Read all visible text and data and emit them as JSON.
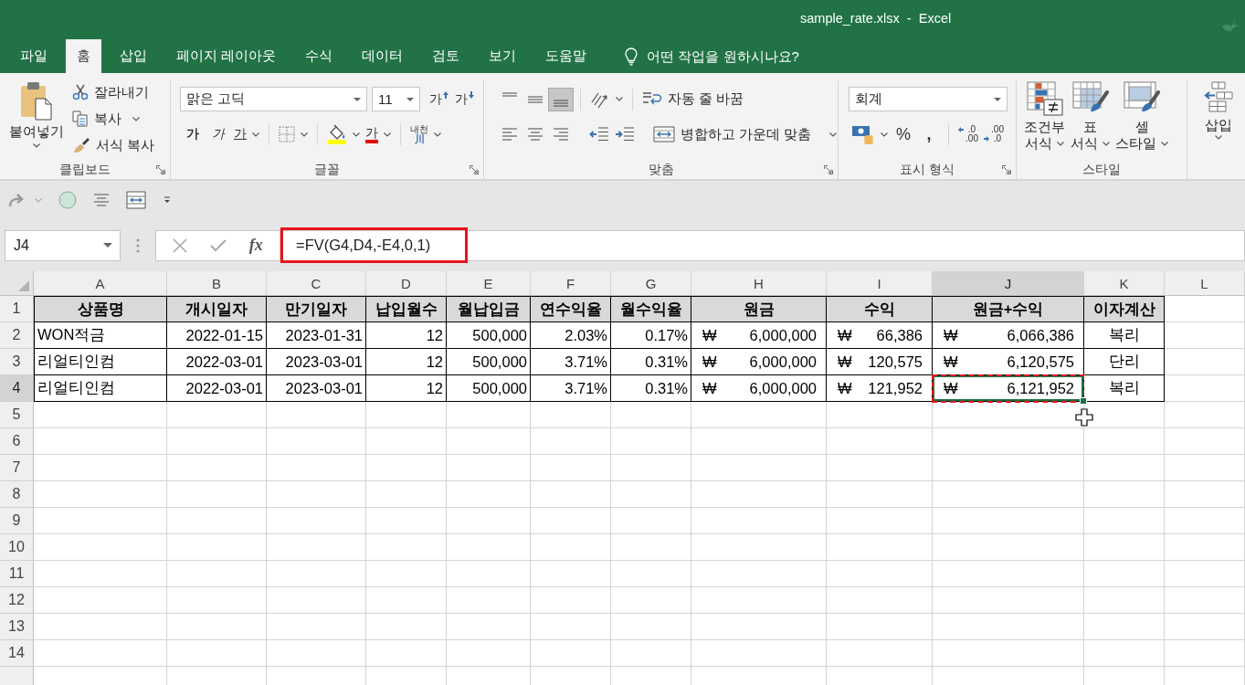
{
  "window": {
    "title": "sample_rate.xlsx  -  Excel"
  },
  "menu_tabs": [
    {
      "label": "파일",
      "selected": false
    },
    {
      "label": "홈",
      "selected": true
    },
    {
      "label": "삽입",
      "selected": false
    },
    {
      "label": "페이지 레이아웃",
      "selected": false
    },
    {
      "label": "수식",
      "selected": false
    },
    {
      "label": "데이터",
      "selected": false
    },
    {
      "label": "검토",
      "selected": false
    },
    {
      "label": "보기",
      "selected": false
    },
    {
      "label": "도움말",
      "selected": false
    }
  ],
  "tell_me": {
    "placeholder": "어떤 작업을 원하시나요?"
  },
  "ribbon": {
    "clipboard": {
      "title": "클립보드",
      "paste": "붙여넣기",
      "cut": "잘라내기",
      "copy": "복사",
      "format_painter": "서식 복사"
    },
    "font": {
      "title": "글꼴",
      "font_name": "맑은 고딕",
      "font_size": "11",
      "grow": "가",
      "shrink": "가",
      "bold": "가",
      "italic": "가",
      "underline": "가",
      "font_color": "가",
      "phonetic": {
        "top": "내천",
        "bottom": "川"
      }
    },
    "alignment": {
      "title": "맞춤",
      "vertical": [
        {
          "kind": "top",
          "selected": false
        },
        {
          "kind": "middle",
          "selected": false
        },
        {
          "kind": "bottom",
          "selected": true
        }
      ],
      "horizontal": [
        {
          "kind": "left",
          "selected": false
        },
        {
          "kind": "center",
          "selected": false
        },
        {
          "kind": "right",
          "selected": false
        }
      ],
      "wrap_text": "자동 줄 바꿈",
      "merge_center": "병합하고 가운데 맞춤"
    },
    "number": {
      "title": "표시 형식",
      "format": "회계",
      "percent": "%",
      "comma": ",",
      "increase_decimal": {
        "top": ".0",
        "bottom": ".00"
      },
      "decrease_decimal": {
        "top": ".00",
        "bottom": ".0"
      }
    },
    "styles": {
      "title": "스타일",
      "buttons": [
        {
          "kind": "conditional",
          "lines": [
            "조건부",
            "서식"
          ]
        },
        {
          "kind": "table",
          "lines": [
            "표",
            "서식"
          ]
        },
        {
          "kind": "cell",
          "lines": [
            "셀",
            "스타일"
          ]
        }
      ]
    },
    "cells": {
      "insert": "삽입"
    }
  },
  "formula_bar": {
    "name_box": "J4",
    "function_label": "fx",
    "formula": "=FV(G4,D4,-E4,0,1)",
    "highlighted": true
  },
  "grid": {
    "columns": [
      {
        "label": "A",
        "selected": false
      },
      {
        "label": "B",
        "selected": false
      },
      {
        "label": "C",
        "selected": false
      },
      {
        "label": "D",
        "selected": false
      },
      {
        "label": "E",
        "selected": false
      },
      {
        "label": "F",
        "selected": false
      },
      {
        "label": "G",
        "selected": false
      },
      {
        "label": "H",
        "selected": false
      },
      {
        "label": "I",
        "selected": false
      },
      {
        "label": "J",
        "selected": true
      },
      {
        "label": "K",
        "selected": false
      },
      {
        "label": "L",
        "selected": false
      }
    ],
    "rows": [
      {
        "label": "1",
        "selected": false,
        "cells": [
          {
            "kind": "header",
            "text": "상품명",
            "selected": false
          },
          {
            "kind": "header",
            "text": "개시일자",
            "selected": false
          },
          {
            "kind": "header",
            "text": "만기일자",
            "selected": false
          },
          {
            "kind": "header",
            "text": "납입월수",
            "selected": false
          },
          {
            "kind": "header",
            "text": "월납입금",
            "selected": false
          },
          {
            "kind": "header",
            "text": "연수익율",
            "selected": false
          },
          {
            "kind": "header",
            "text": "월수익율",
            "selected": false
          },
          {
            "kind": "header",
            "text": "원금",
            "selected": false
          },
          {
            "kind": "header",
            "text": "수익",
            "selected": false
          },
          {
            "kind": "header",
            "text": "원금+수익",
            "selected": false
          },
          {
            "kind": "header",
            "text": "이자계산",
            "selected": false
          }
        ]
      },
      {
        "label": "2",
        "selected": false,
        "cells": [
          {
            "kind": "text",
            "text": "WON적금",
            "selected": false
          },
          {
            "kind": "number",
            "text": "2022-01-15",
            "selected": false
          },
          {
            "kind": "number",
            "text": "2023-01-31",
            "selected": false
          },
          {
            "kind": "number",
            "text": "12",
            "selected": false
          },
          {
            "kind": "number",
            "text": "500,000",
            "selected": false
          },
          {
            "kind": "number",
            "text": "2.03%",
            "selected": false
          },
          {
            "kind": "number",
            "text": "0.17%",
            "selected": false
          },
          {
            "kind": "currency",
            "symbol": "₩",
            "text": "6,000,000",
            "selected": false
          },
          {
            "kind": "currency",
            "symbol": "₩",
            "text": "66,386",
            "selected": false
          },
          {
            "kind": "currency",
            "symbol": "₩",
            "text": "6,066,386",
            "selected": false
          },
          {
            "kind": "centered",
            "text": "복리",
            "selected": false
          }
        ]
      },
      {
        "label": "3",
        "selected": false,
        "cells": [
          {
            "kind": "text",
            "text": "리얼티인컴",
            "selected": false
          },
          {
            "kind": "number",
            "text": "2022-03-01",
            "selected": false
          },
          {
            "kind": "number",
            "text": "2023-03-01",
            "selected": false
          },
          {
            "kind": "number",
            "text": "12",
            "selected": false
          },
          {
            "kind": "number",
            "text": "500,000",
            "selected": false
          },
          {
            "kind": "number",
            "text": "3.71%",
            "selected": false
          },
          {
            "kind": "number",
            "text": "0.31%",
            "selected": false
          },
          {
            "kind": "currency",
            "symbol": "₩",
            "text": "6,000,000",
            "selected": false
          },
          {
            "kind": "currency",
            "symbol": "₩",
            "text": "120,575",
            "selected": false
          },
          {
            "kind": "currency",
            "symbol": "₩",
            "text": "6,120,575",
            "selected": false
          },
          {
            "kind": "centered",
            "text": "단리",
            "selected": false
          }
        ]
      },
      {
        "label": "4",
        "selected": true,
        "cells": [
          {
            "kind": "text",
            "text": "리얼티인컴",
            "selected": false
          },
          {
            "kind": "number",
            "text": "2022-03-01",
            "selected": false
          },
          {
            "kind": "number",
            "text": "2023-03-01",
            "selected": false
          },
          {
            "kind": "number",
            "text": "12",
            "selected": false
          },
          {
            "kind": "number",
            "text": "500,000",
            "selected": false
          },
          {
            "kind": "number",
            "text": "3.71%",
            "selected": false
          },
          {
            "kind": "number",
            "text": "0.31%",
            "selected": false
          },
          {
            "kind": "currency",
            "symbol": "₩",
            "text": "6,000,000",
            "selected": false
          },
          {
            "kind": "currency",
            "symbol": "₩",
            "text": "121,952",
            "selected": false
          },
          {
            "kind": "currency",
            "symbol": "₩",
            "text": "6,121,952",
            "selected": true
          },
          {
            "kind": "centered",
            "text": "복리",
            "selected": false
          }
        ]
      },
      {
        "label": "5",
        "selected": false
      },
      {
        "label": "6",
        "selected": false
      },
      {
        "label": "7",
        "selected": false
      },
      {
        "label": "8",
        "selected": false
      },
      {
        "label": "9",
        "selected": false
      },
      {
        "label": "10",
        "selected": false
      },
      {
        "label": "11",
        "selected": false
      },
      {
        "label": "12",
        "selected": false
      },
      {
        "label": "13",
        "selected": false
      },
      {
        "label": "14",
        "selected": false
      }
    ]
  }
}
